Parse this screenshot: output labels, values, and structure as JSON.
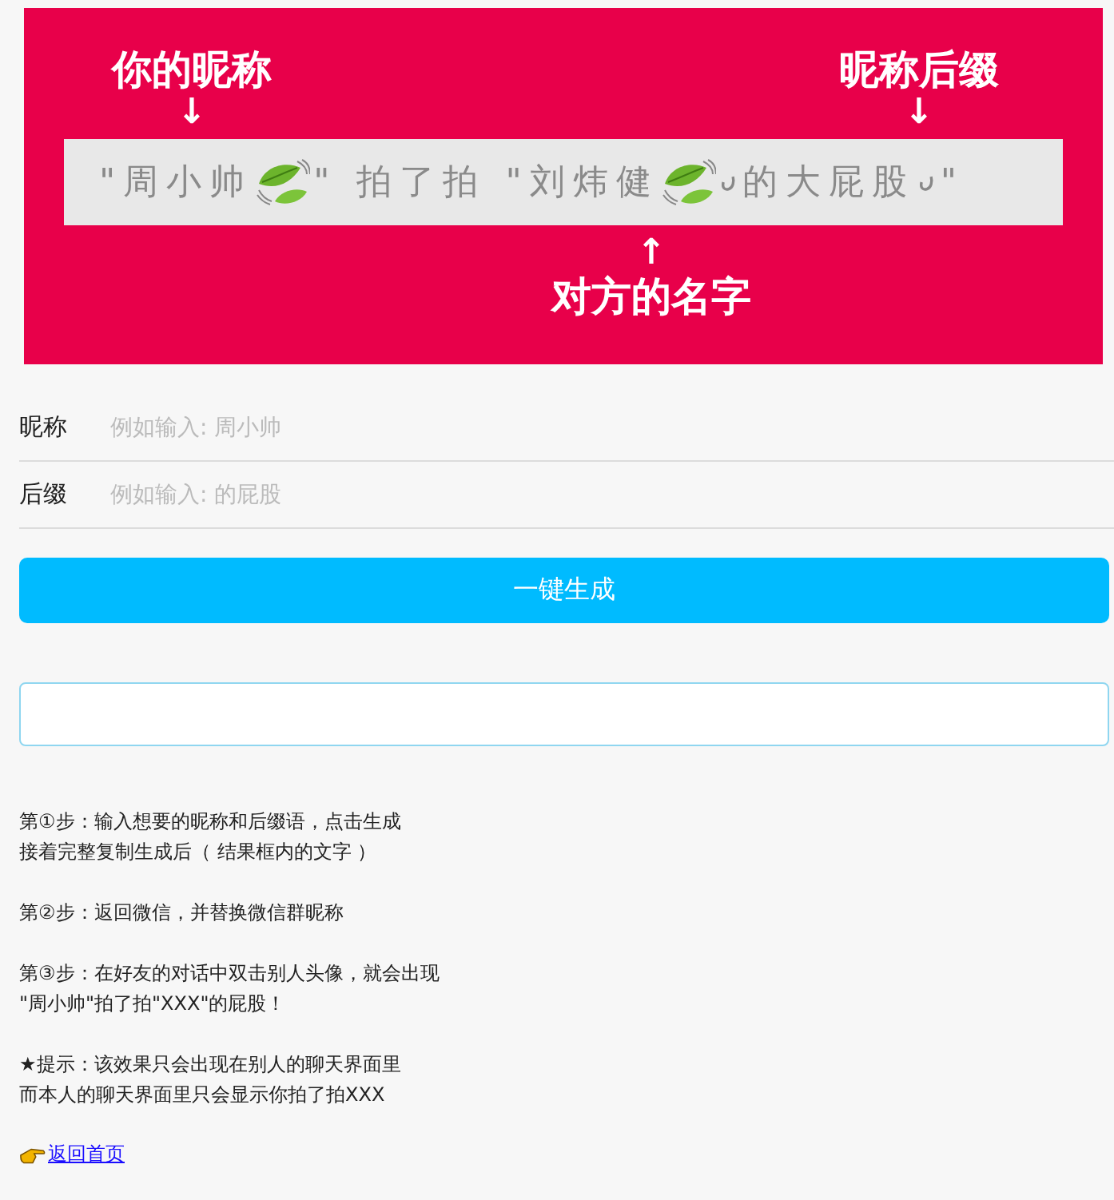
{
  "banner": {
    "nickname_label": "你的昵称",
    "nickname_arrow": "↓",
    "suffix_label": "昵称后缀",
    "suffix_arrow": "↓",
    "strip": [
      {
        "kind": "text",
        "text": "\"周小帅"
      },
      {
        "kind": "leaf"
      },
      {
        "kind": "text",
        "text": "\" 拍了拍 \"刘炜健"
      },
      {
        "kind": "leaf"
      },
      {
        "kind": "hook"
      },
      {
        "kind": "text",
        "text": "的大屁股"
      },
      {
        "kind": "hook"
      },
      {
        "kind": "text",
        "text": "\""
      }
    ],
    "target_arrow": "↑",
    "target_label": "对方的名字"
  },
  "form": [
    {
      "label": "昵称",
      "placeholder": "例如输入: 周小帅"
    },
    {
      "label": "后缀",
      "placeholder": "例如输入: 的屁股"
    }
  ],
  "generate_button": "一键生成",
  "instructions": [
    [
      "第①步：输入想要的昵称和后缀语，点击生成",
      "接着完整复制生成后（ 结果框内的文字 ）"
    ],
    [
      "第②步：返回微信，并替换微信群昵称"
    ],
    [
      "第③步：在好友的对话中双击别人头像，就会出现",
      "\"周小帅\"拍了拍\"XXX\"的屁股！"
    ],
    [
      "★提示：该效果只会出现在别人的聊天界面里",
      "而本人的聊天界面里只会显示你拍了拍XXX"
    ]
  ],
  "back_link": "返回首页"
}
